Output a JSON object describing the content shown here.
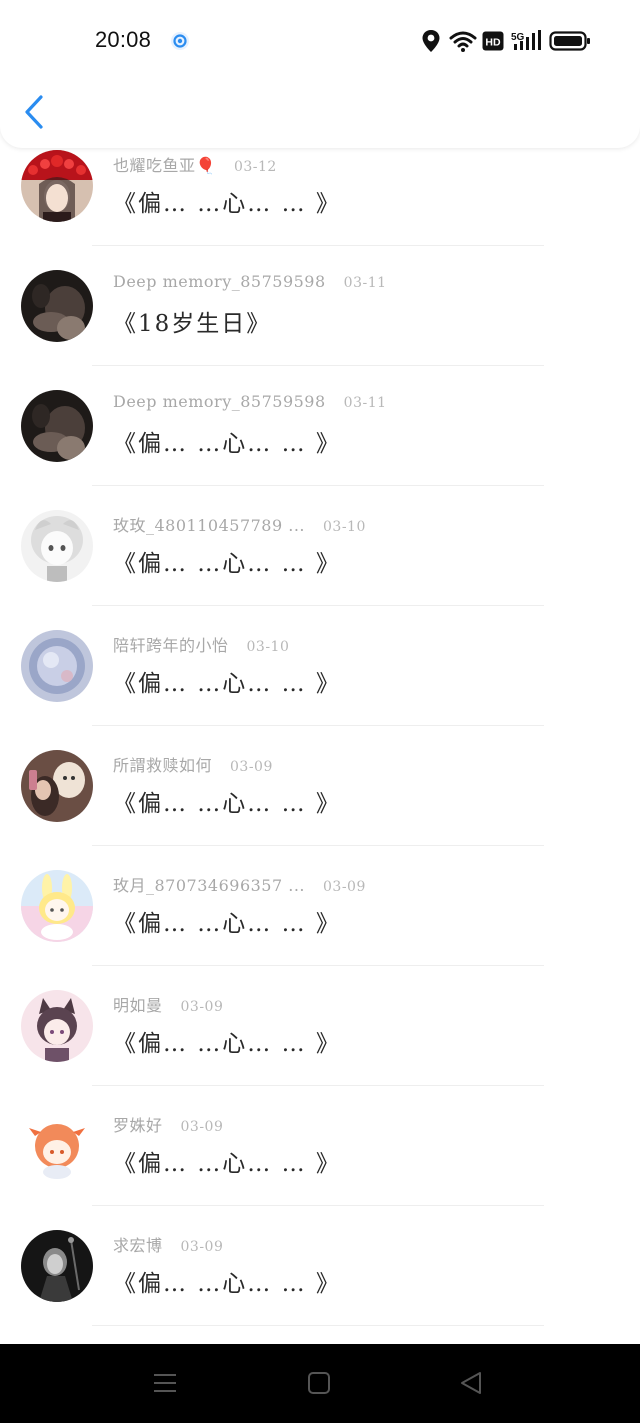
{
  "status_bar": {
    "time": "20:08",
    "notification_icon": "at-circle-icon",
    "icons": [
      "location-icon",
      "wifi-icon",
      "hd-icon",
      "signal-5g-icon",
      "battery-icon"
    ],
    "hd_label": "HD",
    "network_label": "5G"
  },
  "header": {
    "back_icon": "chevron-left-icon"
  },
  "comments": [
    {
      "username": "也耀吃鱼亚🎈",
      "date": "03-12",
      "text": "《偏… …心… … 》"
    },
    {
      "username": "Deep memory_85759598",
      "date": "03-11",
      "text": "《18岁生日》"
    },
    {
      "username": "Deep memory_85759598",
      "date": "03-11",
      "text": "《偏… …心… … 》"
    },
    {
      "username": "玫玫_480110457789 ...",
      "date": "03-10",
      "text": "《偏… …心… … 》"
    },
    {
      "username": "陪轩跨年的小怡",
      "date": "03-10",
      "text": "《偏… …心… … 》"
    },
    {
      "username": "所謂救赎如何",
      "date": "03-09",
      "text": "《偏… …心… … 》"
    },
    {
      "username": "玫月_870734696357 ...",
      "date": "03-09",
      "text": "《偏… …心… … 》"
    },
    {
      "username": "明如曼",
      "date": "03-09",
      "text": "《偏… …心… … 》"
    },
    {
      "username": "罗姝好",
      "date": "03-09",
      "text": "《偏… …心… … 》"
    },
    {
      "username": "求宏博",
      "date": "03-09",
      "text": "《偏… …心… … 》"
    }
  ],
  "nav_bar": {
    "icons": [
      "menu-icon",
      "home-square-icon",
      "back-triangle-icon"
    ]
  },
  "colors": {
    "accent": "#2a8cf0",
    "nav_background": "#000000"
  }
}
